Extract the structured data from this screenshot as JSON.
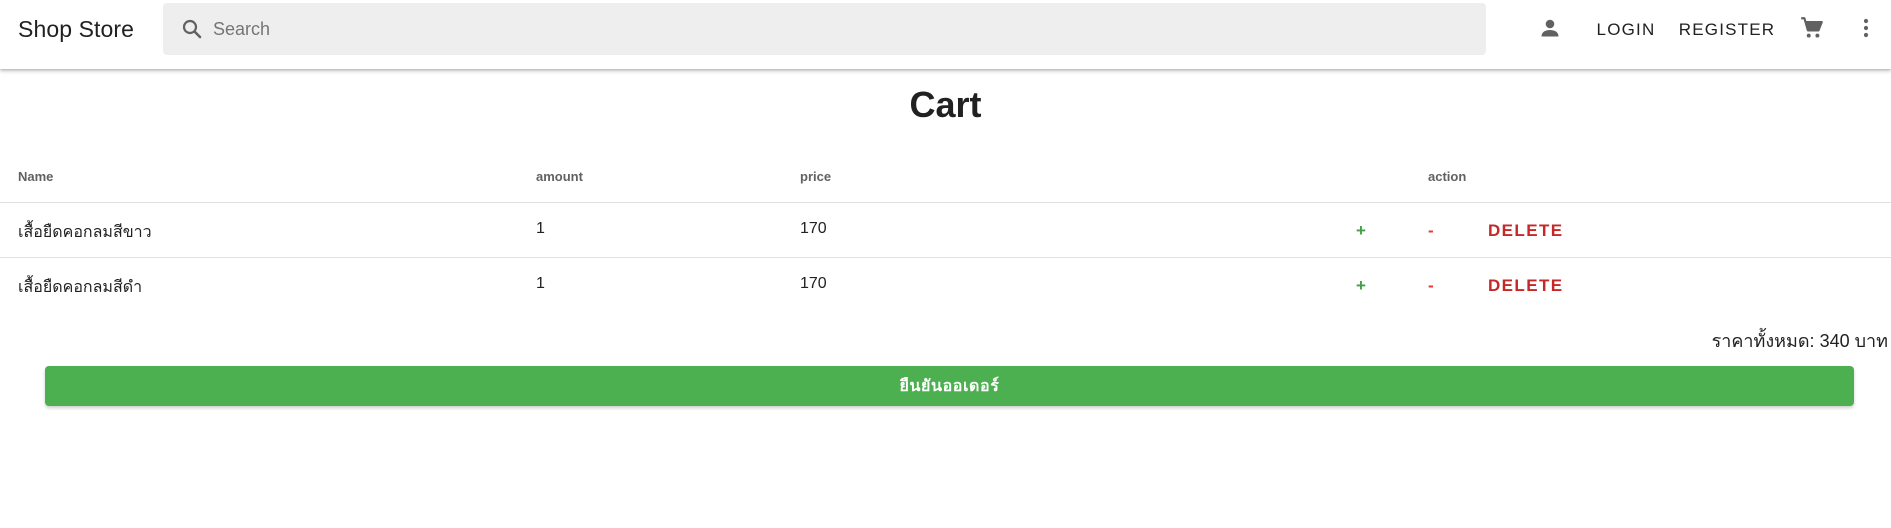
{
  "header": {
    "brand": "Shop Store",
    "search": {
      "placeholder": "Search",
      "value": "",
      "icon": "search-icon"
    },
    "account_icon": "person-icon",
    "login_label": "LOGIN",
    "register_label": "REGISTER",
    "cart_icon": "shopping-cart-icon",
    "more_icon": "more-vert-icon"
  },
  "page": {
    "title": "Cart"
  },
  "cart_table": {
    "columns": {
      "name": "Name",
      "amount": "amount",
      "price": "price",
      "action": "action"
    },
    "rows": [
      {
        "name": "เสื้อยืดคอกลมสีขาว",
        "amount": "1",
        "price": "170",
        "plus_label": "+",
        "minus_label": "-",
        "delete_label": "DELETE"
      },
      {
        "name": "เสื้อยืดคอกลมสีดำ",
        "amount": "1",
        "price": "170",
        "plus_label": "+",
        "minus_label": "-",
        "delete_label": "DELETE"
      }
    ]
  },
  "summary": {
    "total_text": "ราคาทั้งหมด: 340 บาท",
    "confirm_label": "ยืนยันออเดอร์"
  },
  "colors": {
    "confirm_button": "#4caf50",
    "plus": "#43a047",
    "minus": "#e53935",
    "delete": "#c62828",
    "search_bg": "#eeeeee"
  }
}
